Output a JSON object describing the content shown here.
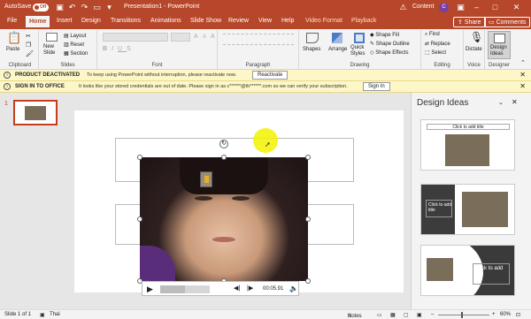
{
  "titlebar": {
    "autosave_label": "AutoSave",
    "autosave_state": "Off",
    "title": "Presentation1  -  PowerPoint",
    "user": "Content",
    "avatar_initial": "C"
  },
  "tabs": [
    "File",
    "Home",
    "Insert",
    "Design",
    "Transitions",
    "Animations",
    "Slide Show",
    "Review",
    "View",
    "Help",
    "Video Format",
    "Playback"
  ],
  "active_tab": "Home",
  "share_label": "Share",
  "comments_label": "Comments",
  "ribbon": {
    "clipboard": {
      "label": "Clipboard",
      "paste": "Paste"
    },
    "slides": {
      "label": "Slides",
      "new_slide": "New\nSlide",
      "layout": "Layout",
      "reset": "Reset",
      "section": "Section"
    },
    "font": {
      "label": "Font"
    },
    "paragraph": {
      "label": "Paragraph"
    },
    "drawing": {
      "label": "Drawing",
      "shapes": "Shapes",
      "arrange": "Arrange",
      "quick_styles": "Quick\nStyles",
      "shape_fill": "Shape Fill",
      "shape_outline": "Shape Outline",
      "shape_effects": "Shape Effects"
    },
    "editing": {
      "label": "Editing",
      "find": "Find",
      "replace": "Replace",
      "select": "Select"
    },
    "voice": {
      "label": "Voice",
      "dictate": "Dictate"
    },
    "designer": {
      "label": "Designer",
      "design_ideas": "Design\nIdeas"
    }
  },
  "notices": [
    {
      "title": "PRODUCT DEACTIVATED",
      "message": "To keep using PowerPoint without interruption, please reactivate now.",
      "button": "Reactivate"
    },
    {
      "title": "SIGN IN TO OFFICE",
      "message": "It looks like your stored credentials are out of date. Please sign in as c******@th******.com so we can verify your subscription.",
      "button": "Sign In"
    }
  ],
  "thumbnail": {
    "number": "1"
  },
  "video": {
    "time": "00:05.91"
  },
  "design_panel": {
    "title": "Design Ideas",
    "cards": [
      {
        "caption": "Click to add title"
      },
      {
        "caption": "Click to add\ntitle"
      },
      {
        "caption": "Click to add\ntitle"
      }
    ]
  },
  "statusbar": {
    "slide": "Slide 1 of 1",
    "language": "Thai",
    "notes": "Notes",
    "zoom": "60%"
  },
  "colors": {
    "brand": "#b7472a",
    "notice": "#fdf6c6",
    "highlight": "#f2f200"
  }
}
